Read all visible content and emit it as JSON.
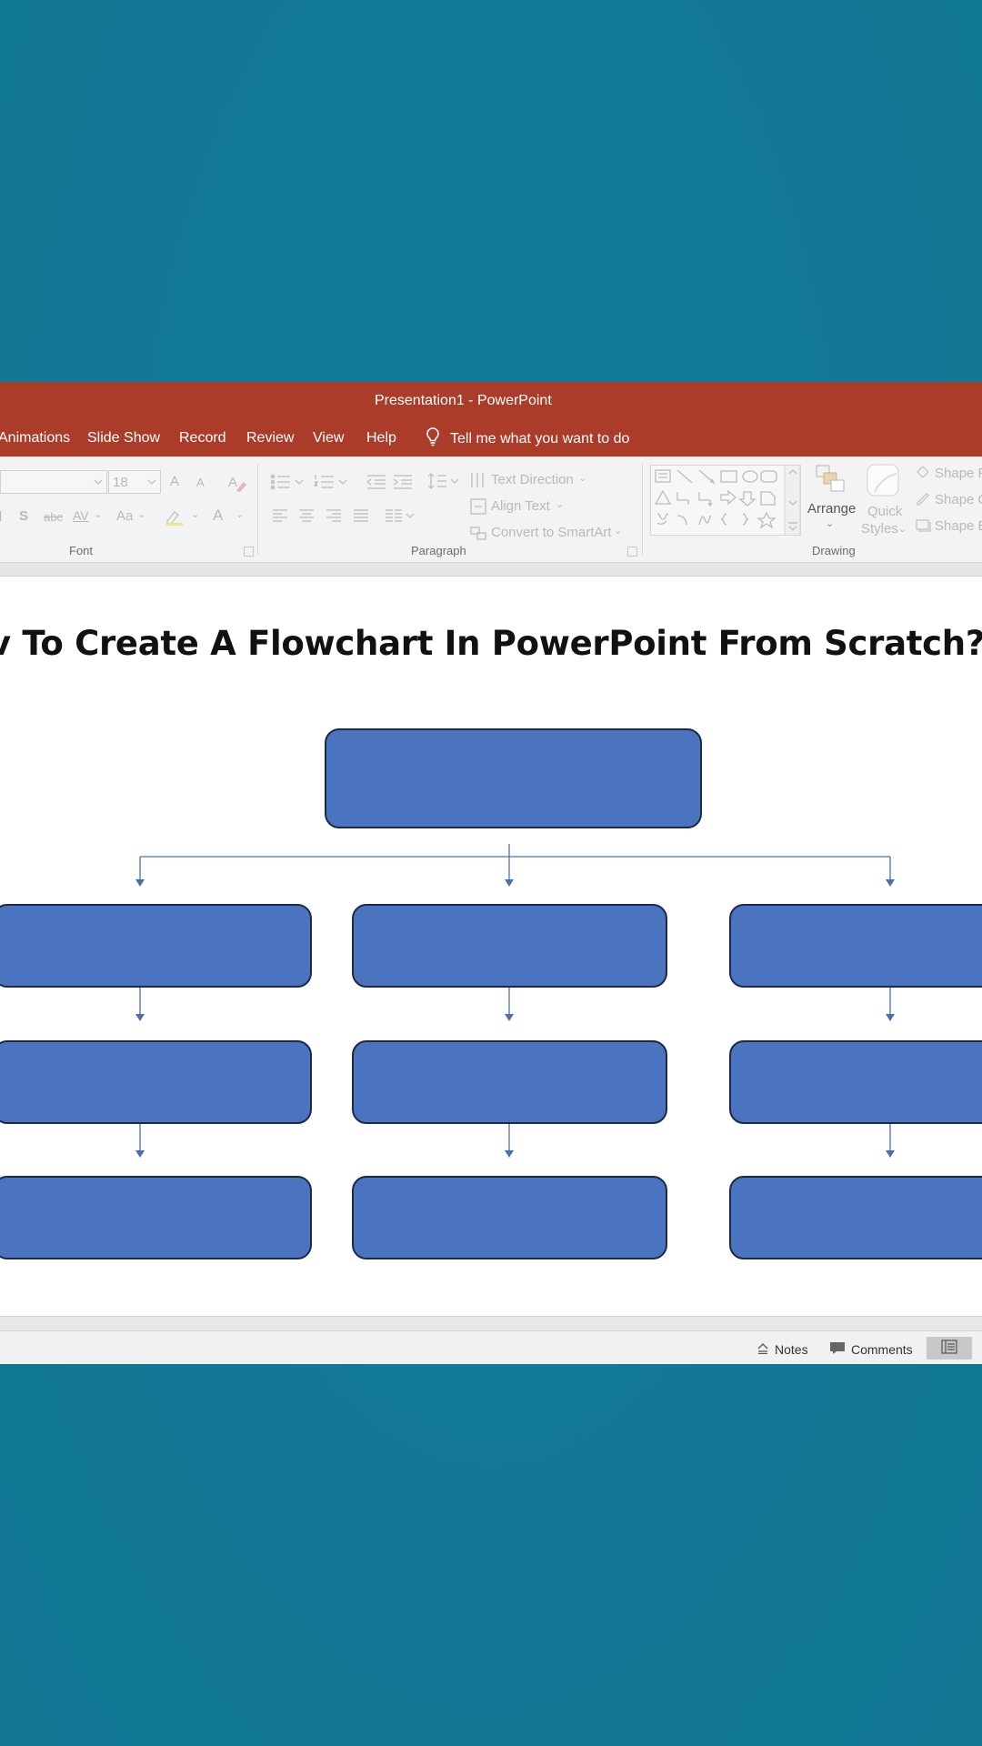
{
  "window": {
    "title": "Presentation1  -  PowerPoint"
  },
  "tabs": [
    {
      "label": "Animations"
    },
    {
      "label": "Slide Show"
    },
    {
      "label": "Record"
    },
    {
      "label": "Review"
    },
    {
      "label": "View"
    },
    {
      "label": "Help"
    }
  ],
  "tell_me": {
    "label": "Tell me what you want to do",
    "icon": "lightbulb-icon"
  },
  "ribbon": {
    "font": {
      "group_label": "Font",
      "size_value": "18",
      "grow_label": "A",
      "shrink_label": "A",
      "shadow_label": "S",
      "strike_label": "abc",
      "spacing_label": "AV",
      "case_label": "Aa",
      "color_label": "A"
    },
    "paragraph": {
      "group_label": "Paragraph",
      "text_direction": "Text Direction",
      "align_text": "Align Text",
      "convert_smartart": "Convert to SmartArt"
    },
    "drawing": {
      "group_label": "Drawing",
      "arrange": "Arrange",
      "quick_styles_1": "Quick",
      "quick_styles_2": "Styles",
      "shape_fill": "Shape F",
      "shape_outline": "Shape O",
      "shape_effects": "Shape E"
    }
  },
  "slide": {
    "title": "v To Create A Flowchart In PowerPoint From Scratch?",
    "box_color": "#4b74c0",
    "box_border": "#1c2a44",
    "connector_color": "#4a6fb0"
  },
  "status": {
    "notes": "Notes",
    "comments": "Comments"
  },
  "colors": {
    "background": "#127996",
    "titlebar": "#ab3c2a",
    "ribbon": "#f3f3f3"
  }
}
